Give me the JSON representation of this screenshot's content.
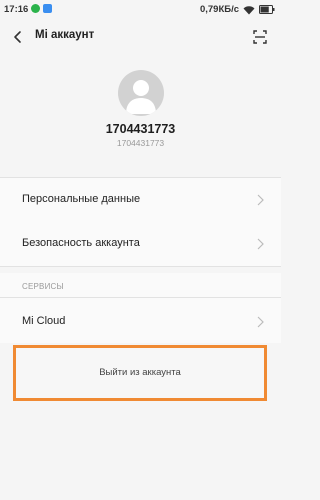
{
  "status_bar": {
    "time": "17:16",
    "network_speed": "0,79КБ/с",
    "battery_level": 0.75,
    "app_icons": [
      "whatsapp-icon",
      "app-notification-icon"
    ]
  },
  "header": {
    "title": "Mi аккаунт",
    "back_icon": "chevron-left-icon",
    "scan_icon": "scan-icon"
  },
  "profile": {
    "name": "1704431773",
    "account_id": "1704431773"
  },
  "account_settings": [
    {
      "label": "Персональные данные"
    },
    {
      "label": "Безопасность аккаунта"
    }
  ],
  "services": {
    "header": "СЕРВИСЫ",
    "items": [
      {
        "label": "Mi Cloud"
      }
    ]
  },
  "logout": {
    "label": "Выйти из аккаунта"
  },
  "colors": {
    "highlight_border": "#f08a33",
    "background": "#f5f5f5",
    "list_background": "#fafafa"
  }
}
